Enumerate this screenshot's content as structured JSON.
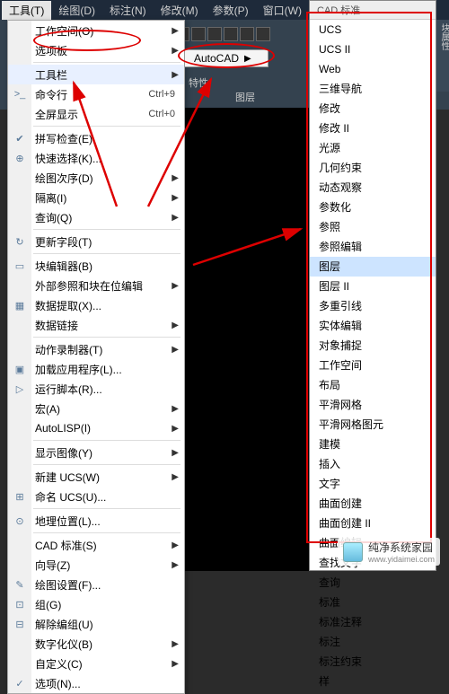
{
  "topbar": [
    {
      "label": "工具(T)",
      "active": true
    },
    {
      "label": "绘图(D)",
      "active": false
    },
    {
      "label": "标注(N)",
      "active": false
    },
    {
      "label": "修改(M)",
      "active": false
    },
    {
      "label": "参数(P)",
      "active": false
    },
    {
      "label": "窗口(W)",
      "active": false
    }
  ],
  "submenu_autocad": "AutoCAD",
  "bg_labels": {
    "props": "特性",
    "layers": "图层",
    "block_props": "块属性"
  },
  "cad_header": "CAD 标准",
  "mainmenu": [
    {
      "label": "工作空间(O)",
      "sub": true
    },
    {
      "label": "选项板",
      "sub": true
    },
    {
      "label": "工具栏",
      "sub": true,
      "highlight": true,
      "sep_before": true
    },
    {
      "label": "命令行",
      "shortcut": "Ctrl+9",
      "icon": ">_"
    },
    {
      "label": "全屏显示",
      "shortcut": "Ctrl+0"
    },
    {
      "label": "拼写检查(E)",
      "icon": "✔",
      "sep_before": true
    },
    {
      "label": "快速选择(K)...",
      "icon": "⊕"
    },
    {
      "label": "绘图次序(D)",
      "sub": true
    },
    {
      "label": "隔离(I)",
      "sub": true
    },
    {
      "label": "查询(Q)",
      "sub": true
    },
    {
      "label": "更新字段(T)",
      "icon": "↻",
      "sep_before": true
    },
    {
      "label": "块编辑器(B)",
      "icon": "▭",
      "sep_before": true
    },
    {
      "label": "外部参照和块在位编辑",
      "sub": true
    },
    {
      "label": "数据提取(X)...",
      "icon": "▦"
    },
    {
      "label": "数据链接",
      "sub": true
    },
    {
      "label": "动作录制器(T)",
      "sub": true,
      "sep_before": true
    },
    {
      "label": "加载应用程序(L)...",
      "icon": "▣"
    },
    {
      "label": "运行脚本(R)...",
      "icon": "▷"
    },
    {
      "label": "宏(A)",
      "sub": true
    },
    {
      "label": "AutoLISP(I)",
      "sub": true
    },
    {
      "label": "显示图像(Y)",
      "sub": true,
      "sep_before": true
    },
    {
      "label": "新建 UCS(W)",
      "sub": true,
      "sep_before": true
    },
    {
      "label": "命名 UCS(U)...",
      "icon": "⊞"
    },
    {
      "label": "地理位置(L)...",
      "icon": "⊙",
      "sep_before": true
    },
    {
      "label": "CAD 标准(S)",
      "sub": true,
      "sep_before": true
    },
    {
      "label": "向导(Z)",
      "sub": true
    },
    {
      "label": "绘图设置(F)...",
      "icon": "✎"
    },
    {
      "label": "组(G)",
      "icon": "⊡"
    },
    {
      "label": "解除编组(U)",
      "icon": "⊟"
    },
    {
      "label": "数字化仪(B)",
      "sub": true
    },
    {
      "label": "自定义(C)",
      "sub": true
    },
    {
      "label": "选项(N)...",
      "icon": "✓"
    }
  ],
  "rightmenu": [
    "UCS",
    "UCS II",
    "Web",
    "三维导航",
    "修改",
    "修改 II",
    "光源",
    "几何约束",
    "动态观察",
    "参数化",
    "参照",
    "参照编辑",
    "图层",
    "图层 II",
    "多重引线",
    "实体编辑",
    "对象捕捉",
    "工作空间",
    "布局",
    "平滑网格",
    "平滑网格图元",
    "建模",
    "插入",
    "文字",
    "曲面创建",
    "曲面创建 II",
    "曲面编辑",
    "查找文字",
    "查询",
    "标准",
    "标准注释",
    "标注",
    "标注约束",
    "样"
  ],
  "right_highlight_index": 12,
  "watermark": {
    "text": "纯净系统家园",
    "url": "www.yidaimei.com"
  }
}
